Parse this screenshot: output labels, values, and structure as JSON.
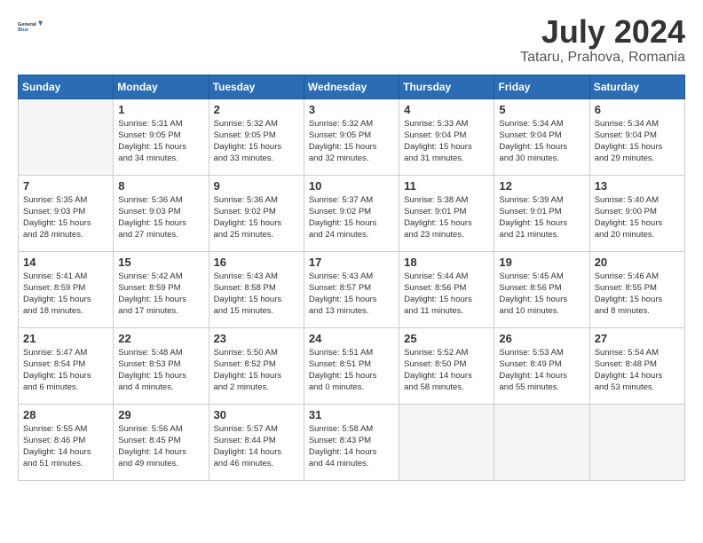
{
  "header": {
    "logo_line1": "General",
    "logo_line2": "Blue",
    "title": "July 2024",
    "subtitle": "Tataru, Prahova, Romania"
  },
  "calendar": {
    "days_of_week": [
      "Sunday",
      "Monday",
      "Tuesday",
      "Wednesday",
      "Thursday",
      "Friday",
      "Saturday"
    ],
    "weeks": [
      [
        {
          "day": "",
          "info": ""
        },
        {
          "day": "1",
          "info": "Sunrise: 5:31 AM\nSunset: 9:05 PM\nDaylight: 15 hours\nand 34 minutes."
        },
        {
          "day": "2",
          "info": "Sunrise: 5:32 AM\nSunset: 9:05 PM\nDaylight: 15 hours\nand 33 minutes."
        },
        {
          "day": "3",
          "info": "Sunrise: 5:32 AM\nSunset: 9:05 PM\nDaylight: 15 hours\nand 32 minutes."
        },
        {
          "day": "4",
          "info": "Sunrise: 5:33 AM\nSunset: 9:04 PM\nDaylight: 15 hours\nand 31 minutes."
        },
        {
          "day": "5",
          "info": "Sunrise: 5:34 AM\nSunset: 9:04 PM\nDaylight: 15 hours\nand 30 minutes."
        },
        {
          "day": "6",
          "info": "Sunrise: 5:34 AM\nSunset: 9:04 PM\nDaylight: 15 hours\nand 29 minutes."
        }
      ],
      [
        {
          "day": "7",
          "info": "Sunrise: 5:35 AM\nSunset: 9:03 PM\nDaylight: 15 hours\nand 28 minutes."
        },
        {
          "day": "8",
          "info": "Sunrise: 5:36 AM\nSunset: 9:03 PM\nDaylight: 15 hours\nand 27 minutes."
        },
        {
          "day": "9",
          "info": "Sunrise: 5:36 AM\nSunset: 9:02 PM\nDaylight: 15 hours\nand 25 minutes."
        },
        {
          "day": "10",
          "info": "Sunrise: 5:37 AM\nSunset: 9:02 PM\nDaylight: 15 hours\nand 24 minutes."
        },
        {
          "day": "11",
          "info": "Sunrise: 5:38 AM\nSunset: 9:01 PM\nDaylight: 15 hours\nand 23 minutes."
        },
        {
          "day": "12",
          "info": "Sunrise: 5:39 AM\nSunset: 9:01 PM\nDaylight: 15 hours\nand 21 minutes."
        },
        {
          "day": "13",
          "info": "Sunrise: 5:40 AM\nSunset: 9:00 PM\nDaylight: 15 hours\nand 20 minutes."
        }
      ],
      [
        {
          "day": "14",
          "info": "Sunrise: 5:41 AM\nSunset: 8:59 PM\nDaylight: 15 hours\nand 18 minutes."
        },
        {
          "day": "15",
          "info": "Sunrise: 5:42 AM\nSunset: 8:59 PM\nDaylight: 15 hours\nand 17 minutes."
        },
        {
          "day": "16",
          "info": "Sunrise: 5:43 AM\nSunset: 8:58 PM\nDaylight: 15 hours\nand 15 minutes."
        },
        {
          "day": "17",
          "info": "Sunrise: 5:43 AM\nSunset: 8:57 PM\nDaylight: 15 hours\nand 13 minutes."
        },
        {
          "day": "18",
          "info": "Sunrise: 5:44 AM\nSunset: 8:56 PM\nDaylight: 15 hours\nand 11 minutes."
        },
        {
          "day": "19",
          "info": "Sunrise: 5:45 AM\nSunset: 8:56 PM\nDaylight: 15 hours\nand 10 minutes."
        },
        {
          "day": "20",
          "info": "Sunrise: 5:46 AM\nSunset: 8:55 PM\nDaylight: 15 hours\nand 8 minutes."
        }
      ],
      [
        {
          "day": "21",
          "info": "Sunrise: 5:47 AM\nSunset: 8:54 PM\nDaylight: 15 hours\nand 6 minutes."
        },
        {
          "day": "22",
          "info": "Sunrise: 5:48 AM\nSunset: 8:53 PM\nDaylight: 15 hours\nand 4 minutes."
        },
        {
          "day": "23",
          "info": "Sunrise: 5:50 AM\nSunset: 8:52 PM\nDaylight: 15 hours\nand 2 minutes."
        },
        {
          "day": "24",
          "info": "Sunrise: 5:51 AM\nSunset: 8:51 PM\nDaylight: 15 hours\nand 0 minutes."
        },
        {
          "day": "25",
          "info": "Sunrise: 5:52 AM\nSunset: 8:50 PM\nDaylight: 14 hours\nand 58 minutes."
        },
        {
          "day": "26",
          "info": "Sunrise: 5:53 AM\nSunset: 8:49 PM\nDaylight: 14 hours\nand 55 minutes."
        },
        {
          "day": "27",
          "info": "Sunrise: 5:54 AM\nSunset: 8:48 PM\nDaylight: 14 hours\nand 53 minutes."
        }
      ],
      [
        {
          "day": "28",
          "info": "Sunrise: 5:55 AM\nSunset: 8:46 PM\nDaylight: 14 hours\nand 51 minutes."
        },
        {
          "day": "29",
          "info": "Sunrise: 5:56 AM\nSunset: 8:45 PM\nDaylight: 14 hours\nand 49 minutes."
        },
        {
          "day": "30",
          "info": "Sunrise: 5:57 AM\nSunset: 8:44 PM\nDaylight: 14 hours\nand 46 minutes."
        },
        {
          "day": "31",
          "info": "Sunrise: 5:58 AM\nSunset: 8:43 PM\nDaylight: 14 hours\nand 44 minutes."
        },
        {
          "day": "",
          "info": ""
        },
        {
          "day": "",
          "info": ""
        },
        {
          "day": "",
          "info": ""
        }
      ]
    ]
  }
}
